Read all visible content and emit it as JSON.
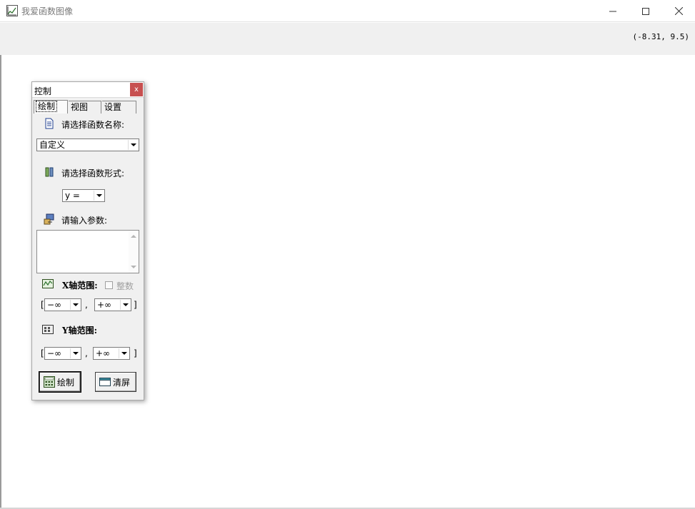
{
  "window": {
    "title": "我爱函数图像",
    "coordinates": "(-8.31, 9.5)"
  },
  "panel": {
    "title": "控制",
    "close_label": "x",
    "tabs": [
      {
        "label": "绘制"
      },
      {
        "label": "视图"
      },
      {
        "label": "设置"
      }
    ],
    "function_name_label": "请选择函数名称:",
    "function_name_value": "自定义",
    "function_form_label": "请选择函数形式:",
    "function_form_value": "y =",
    "params_label": "请输入参数:",
    "params_value": "",
    "x_range_label": "X轴范围:",
    "integer_label": "整数",
    "x_min": "−∞",
    "x_max": "+∞",
    "y_range_label": "Y轴范围:",
    "y_min": "−∞",
    "y_max": "+∞",
    "open_bracket": "[",
    "close_bracket": "]",
    "comma": ",",
    "draw_button": "绘制",
    "clear_button": "清屏"
  }
}
